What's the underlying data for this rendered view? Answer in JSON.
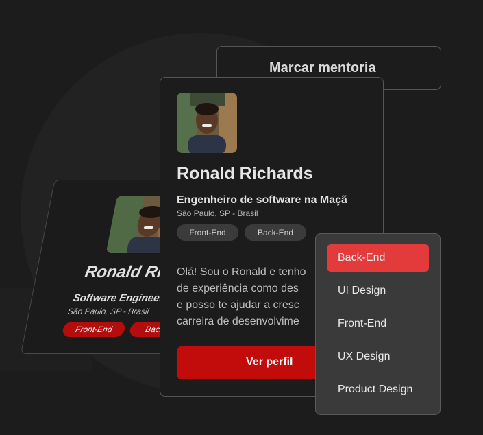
{
  "mentoria_button": {
    "label": "Marcar mentoria"
  },
  "back_card": {
    "name": "Ronald Rich",
    "role": "Software Engineer",
    "location": "São Paulo, SP - Brasil",
    "tags": [
      "Front-End",
      "Back-En"
    ]
  },
  "profile_card": {
    "name": "Ronald Richards",
    "role": "Engenheiro de software na Maçã",
    "location": "São Paulo, SP - Brasil",
    "tags": [
      "Front-End",
      "Back-End"
    ],
    "bio_lines": [
      "Olá! Sou o Ronald e tenho",
      "de experiência como des",
      "e posso te ajudar a cresc",
      "carreira de desenvolvime"
    ],
    "view_profile_label": "Ver perfil"
  },
  "dropdown": {
    "selected": "Back-End",
    "items": [
      "Back-End",
      "UI Design",
      "Front-End",
      "UX Design",
      "Product Design"
    ]
  },
  "colors": {
    "background": "#1c1c1c",
    "accent_red": "#c20c0c",
    "dropdown_active": "#e33b3b",
    "tag_bg": "#3b3b3b"
  }
}
